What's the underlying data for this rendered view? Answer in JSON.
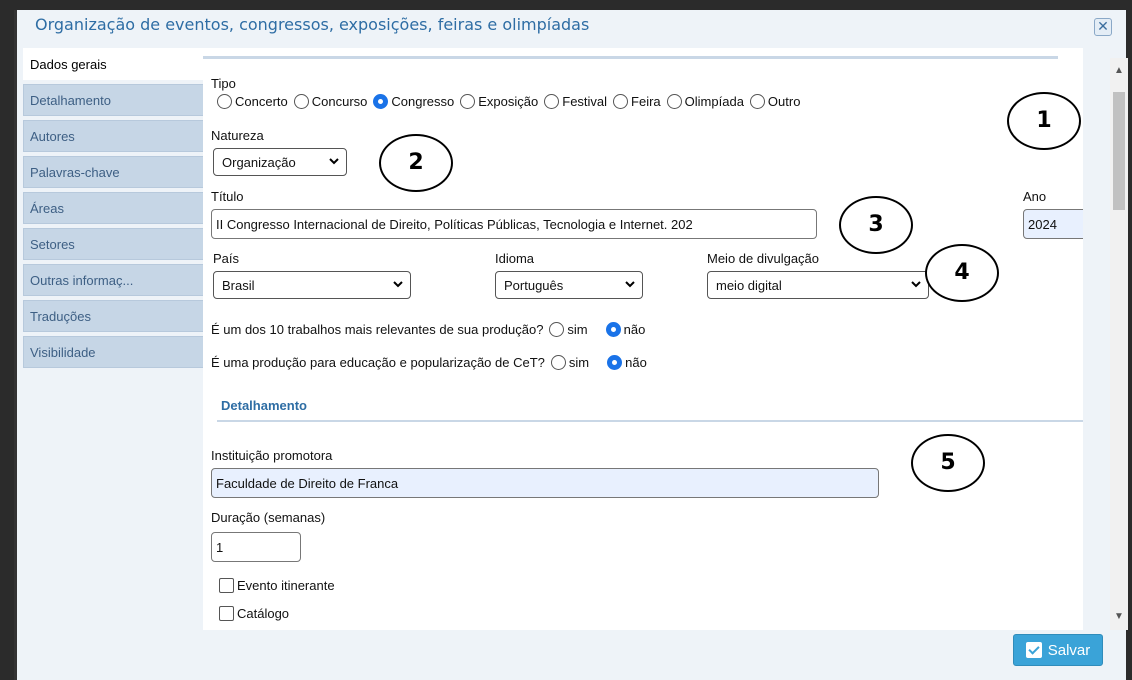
{
  "window": {
    "title": "Organização de eventos, congressos, exposições, feiras e olimpíadas"
  },
  "tabs": [
    {
      "label": "Dados gerais"
    },
    {
      "label": "Detalhamento"
    },
    {
      "label": "Autores"
    },
    {
      "label": "Palavras-chave"
    },
    {
      "label": "Áreas"
    },
    {
      "label": "Setores"
    },
    {
      "label": "Outras informaç..."
    },
    {
      "label": "Traduções"
    },
    {
      "label": "Visibilidade"
    }
  ],
  "form": {
    "tipo_label": "Tipo",
    "tipo_options": [
      "Concerto",
      "Concurso",
      "Congresso",
      "Exposição",
      "Festival",
      "Feira",
      "Olimpíada",
      "Outro"
    ],
    "tipo_selected": "Congresso",
    "natureza_label": "Natureza",
    "natureza_value": "Organização",
    "titulo_label": "Título",
    "titulo_value": "II Congresso Internacional de Direito, Políticas Públicas, Tecnologia e Internet. 202",
    "ano_label": "Ano",
    "ano_value": "2024",
    "pais_label": "País",
    "pais_value": "Brasil",
    "idioma_label": "Idioma",
    "idioma_value": "Português",
    "meio_label": "Meio de divulgação",
    "meio_value": "meio digital",
    "q1_label": "É um dos 10 trabalhos mais relevantes de sua produção?",
    "q2_label": "É uma produção para educação e popularização de CeT?",
    "sim": "sim",
    "nao": "não",
    "detalhamento_title": "Detalhamento",
    "instituicao_label": "Instituição promotora",
    "instituicao_value": "Faculdade de Direito de Franca",
    "duracao_label": "Duração (semanas)",
    "duracao_value": "1",
    "evento_itinerante": "Evento itinerante",
    "catalogo": "Catálogo"
  },
  "callouts": [
    "1",
    "2",
    "3",
    "4",
    "5"
  ],
  "buttons": {
    "save": "Salvar"
  },
  "colors": {
    "accent": "#2e6da4",
    "tab_bg": "#c6d6e6",
    "save_bg": "#3aa3d8",
    "radio_on": "#1a73e8"
  }
}
